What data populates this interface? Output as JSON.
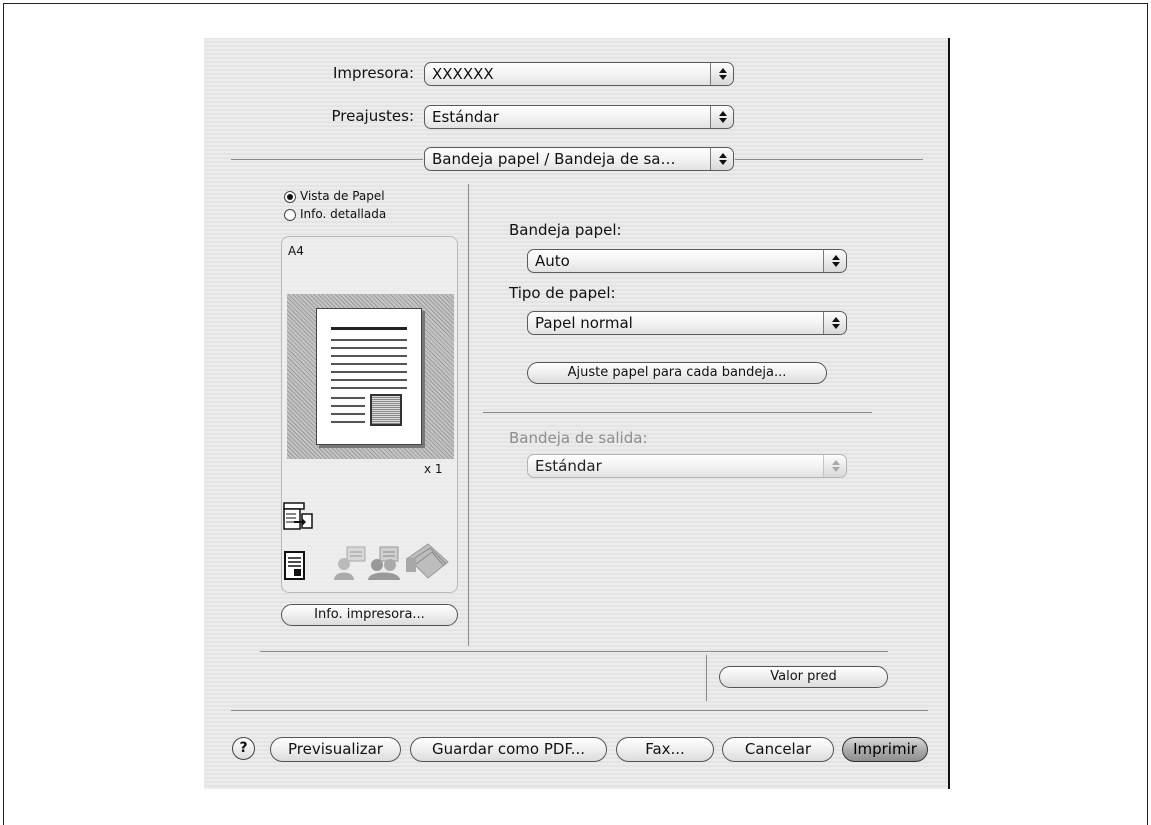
{
  "printer": {
    "label": "Impresora:",
    "value": "XXXXXX"
  },
  "presets": {
    "label": "Preajustes:",
    "value": "Estándar"
  },
  "panel_menu": {
    "value": "Bandeja papel / Bandeja de sa…"
  },
  "view_options": [
    {
      "label": "Vista de Papel",
      "selected": true
    },
    {
      "label": "Info. detallada",
      "selected": false
    }
  ],
  "preview": {
    "paper_size": "A4",
    "copies": "x 1"
  },
  "printer_info_button": "Info. impresora...",
  "paper_tray": {
    "label": "Bandeja papel:",
    "value": "Auto"
  },
  "paper_type": {
    "label": "Tipo de papel:",
    "value": "Papel normal"
  },
  "tray_settings_button": "Ajuste papel para cada bandeja...",
  "output_tray": {
    "label": "Bandeja de salida:",
    "value": "Estándar",
    "enabled": false
  },
  "default_button": "Valor pred",
  "footer": {
    "help": "?",
    "preview": "Previsualizar",
    "save_pdf": "Guardar como PDF...",
    "fax": "Fax...",
    "cancel": "Cancelar",
    "print": "Imprimir"
  },
  "icons": [
    "output-tray-icon",
    "document-icon",
    "user-auth-icon",
    "account-track-icon",
    "finishing-icon"
  ]
}
